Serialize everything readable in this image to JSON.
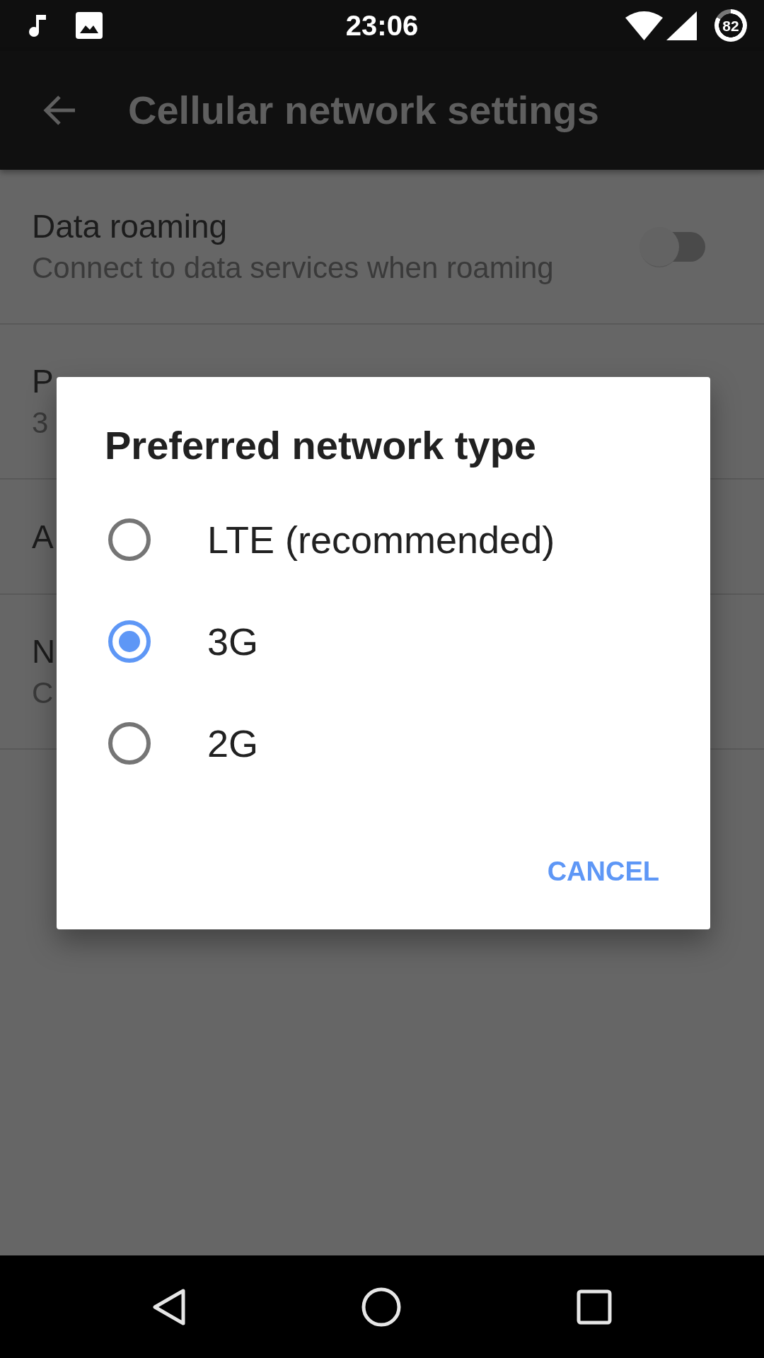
{
  "status_bar": {
    "time": "23:06",
    "battery": "82"
  },
  "app_bar": {
    "title": "Cellular network settings"
  },
  "settings": [
    {
      "kind": "toggle",
      "title": "Data roaming",
      "subtitle": "Connect to data services when roaming",
      "on": false
    },
    {
      "kind": "text",
      "title": "P",
      "subtitle": "3"
    },
    {
      "kind": "text",
      "title": "A"
    },
    {
      "kind": "text",
      "title": "N",
      "subtitle": "C"
    }
  ],
  "dialog": {
    "title": "Preferred network type",
    "options": [
      {
        "label": "LTE (recommended)",
        "selected": false
      },
      {
        "label": "3G",
        "selected": true
      },
      {
        "label": "2G",
        "selected": false
      }
    ],
    "buttons": [
      "CANCEL"
    ]
  }
}
